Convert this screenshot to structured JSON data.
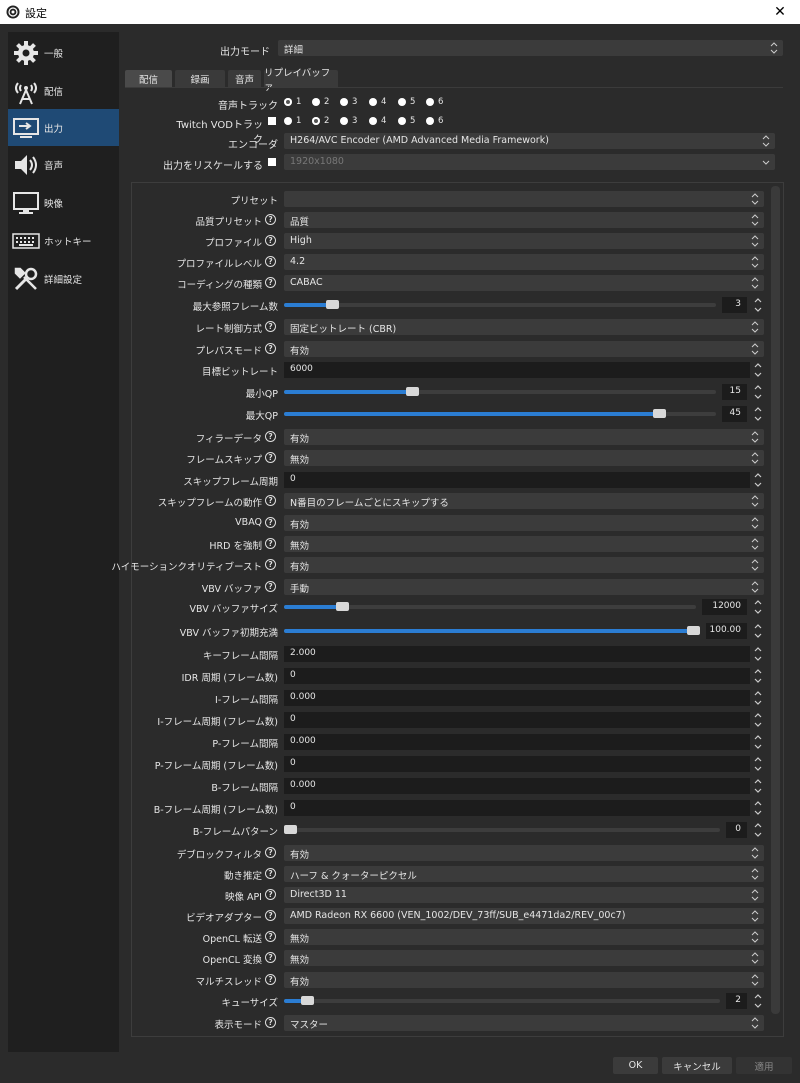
{
  "window": {
    "title": "設定",
    "close_label": "✕"
  },
  "sidebar": {
    "items": [
      {
        "label": "一般",
        "icon": "gear-icon"
      },
      {
        "label": "配信",
        "icon": "antenna-icon"
      },
      {
        "label": "出力",
        "icon": "output-icon",
        "active": true
      },
      {
        "label": "音声",
        "icon": "speaker-icon"
      },
      {
        "label": "映像",
        "icon": "monitor-icon"
      },
      {
        "label": "ホットキー",
        "icon": "keyboard-icon"
      },
      {
        "label": "詳細設定",
        "icon": "tools-icon"
      }
    ]
  },
  "output_mode": {
    "label": "出力モード",
    "value": "詳細"
  },
  "tabs": [
    "配信",
    "録画",
    "音声",
    "リプレイバッファ"
  ],
  "audio_track": {
    "label": "音声トラック",
    "options": [
      "1",
      "2",
      "3",
      "4",
      "5",
      "6"
    ],
    "selected": "1"
  },
  "twitch_vod": {
    "label": "Twitch VODトラック",
    "options": [
      "1",
      "2",
      "3",
      "4",
      "5",
      "6"
    ],
    "selected": "2"
  },
  "encoder": {
    "label": "エンコーダ",
    "value": "H264/AVC Encoder (AMD Advanced Media Framework)"
  },
  "rescale": {
    "label": "出力をリスケールする",
    "value": "1920x1080"
  },
  "settings": {
    "preset": {
      "label": "プリセット",
      "value": ""
    },
    "quality_preset": {
      "label": "品質プリセット",
      "value": "品質"
    },
    "profile": {
      "label": "プロファイル",
      "value": "High"
    },
    "profile_level": {
      "label": "プロファイルレベル",
      "value": "4.2"
    },
    "coding_type": {
      "label": "コーディングの種類",
      "value": "CABAC"
    },
    "max_ref_frames": {
      "label": "最大参照フレーム数",
      "value": "3",
      "level": 0.1
    },
    "rate_control": {
      "label": "レート制御方式",
      "value": "固定ビットレート (CBR)"
    },
    "prepass": {
      "label": "プレパスモード",
      "value": "有効"
    },
    "target_bitrate": {
      "label": "目標ビットレート",
      "value": "6000"
    },
    "min_qp": {
      "label": "最小QP",
      "value": "15",
      "level": 0.29
    },
    "max_qp": {
      "label": "最大QP",
      "value": "45",
      "level": 0.88
    },
    "filler_data": {
      "label": "フィラーデータ",
      "value": "有効"
    },
    "frame_skip": {
      "label": "フレームスキップ",
      "value": "無効"
    },
    "skip_frame_period": {
      "label": "スキップフレーム周期",
      "value": "0"
    },
    "skip_frame_behavior": {
      "label": "スキップフレームの動作",
      "value": "N番目のフレームごとにスキップする"
    },
    "vbaq": {
      "label": "VBAQ",
      "value": "有効"
    },
    "enforce_hrd": {
      "label": "HRD を強制",
      "value": "無効"
    },
    "high_motion": {
      "label": "ハイモーションクオリティブースト",
      "value": "有効"
    },
    "vbv_buffer": {
      "label": "VBV バッファ",
      "value": "手動"
    },
    "vbv_size": {
      "label": "VBV バッファサイズ",
      "value": "12000",
      "level": 0.13
    },
    "vbv_initial": {
      "label": "VBV バッファ初期充満",
      "value": "100.00",
      "level": 1.0
    },
    "keyframe_interval": {
      "label": "キーフレーム間隔",
      "value": "2.000"
    },
    "idr_period": {
      "label": "IDR 周期 (フレーム数)",
      "value": "0"
    },
    "i_frame_interval": {
      "label": "I-フレーム間隔",
      "value": "0.000"
    },
    "i_frame_period": {
      "label": "I-フレーム周期 (フレーム数)",
      "value": "0"
    },
    "p_frame_interval": {
      "label": "P-フレーム間隔",
      "value": "0.000"
    },
    "p_frame_period": {
      "label": "P-フレーム周期 (フレーム数)",
      "value": "0"
    },
    "b_frame_interval": {
      "label": "B-フレーム間隔",
      "value": "0.000"
    },
    "b_frame_period": {
      "label": "B-フレーム周期 (フレーム数)",
      "value": "0"
    },
    "b_frame_pattern": {
      "label": "B-フレームパターン",
      "value": "0",
      "level": 0.0
    },
    "deblock": {
      "label": "デブロックフィルタ",
      "value": "有効"
    },
    "motion_est": {
      "label": "動き推定",
      "value": "ハーフ & クォーターピクセル"
    },
    "video_api": {
      "label": "映像 API",
      "value": "Direct3D 11"
    },
    "adapter": {
      "label": "ビデオアダプター",
      "value": "AMD Radeon RX 6600 (VEN_1002/DEV_73ff/SUB_e4471da2/REV_00c7)"
    },
    "opencl_transfer": {
      "label": "OpenCL 転送",
      "value": "無効"
    },
    "opencl_convert": {
      "label": "OpenCL 変換",
      "value": "無効"
    },
    "multithread": {
      "label": "マルチスレッド",
      "value": "有効"
    },
    "queue_size": {
      "label": "キューサイズ",
      "value": "2",
      "level": 0.04
    },
    "view_mode": {
      "label": "表示モード",
      "value": "マスター"
    }
  },
  "buttons": {
    "ok": "OK",
    "cancel": "キャンセル",
    "apply": "適用"
  }
}
